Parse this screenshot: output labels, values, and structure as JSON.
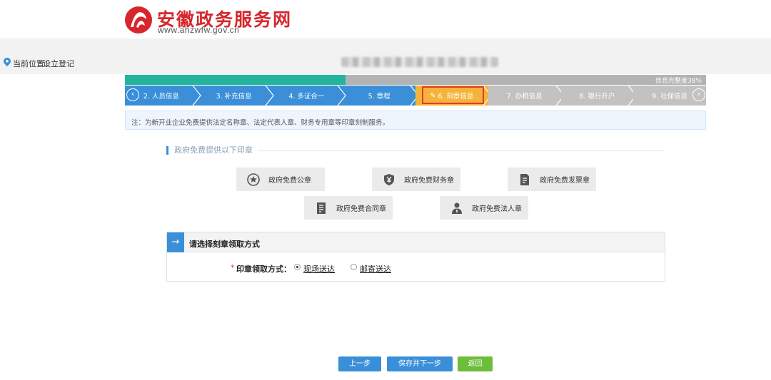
{
  "header": {
    "site_name": "安徽政务服务网",
    "site_url": "www.ahzwfw.gov.cn",
    "brand_color": "#d7262c"
  },
  "location": {
    "label": "当前位置：",
    "current": "设立登记"
  },
  "progress": {
    "text": "信息完整度38%",
    "percent": 38
  },
  "steps": [
    {
      "label": "2. 人员信息",
      "state": "done"
    },
    {
      "label": "3. 补充信息",
      "state": "done"
    },
    {
      "label": "4. 多证合一",
      "state": "done"
    },
    {
      "label": "5. 章程",
      "state": "done"
    },
    {
      "label": "6. 刻章信息",
      "state": "current"
    },
    {
      "label": "7. 办税信息",
      "state": "upcoming"
    },
    {
      "label": "8. 银行开户",
      "state": "upcoming"
    },
    {
      "label": "9. 社保信息",
      "state": "upcoming"
    }
  ],
  "note": "注：为新开业企业免费提供法定名称章、法定代表人章、财务专用章等印章刻制服务。",
  "free_seals": {
    "title": "政府免费提供以下印章",
    "items": [
      {
        "label": "政府免费公章",
        "icon": "star-seal-icon"
      },
      {
        "label": "政府免费财务章",
        "icon": "shield-yen-icon"
      },
      {
        "label": "政府免费发票章",
        "icon": "invoice-doc-icon"
      },
      {
        "label": "政府免费合同章",
        "icon": "contract-doc-icon"
      },
      {
        "label": "政府免费法人章",
        "icon": "person-icon"
      }
    ]
  },
  "method": {
    "title": "请选择刻章领取方式",
    "field_label": "印章领取方式：",
    "options": [
      {
        "label": "现场送达",
        "selected": true
      },
      {
        "label": "邮寄送达",
        "selected": false
      }
    ]
  },
  "buttons": {
    "prev": "上一步",
    "save_next": "保存并下一步",
    "back": "返回"
  },
  "colors": {
    "primary": "#3a8fd8",
    "progress": "#22b59b",
    "current_step": "#f4b33a",
    "upcoming_step": "#c2c2c2",
    "back_button": "#6cbd3a"
  }
}
